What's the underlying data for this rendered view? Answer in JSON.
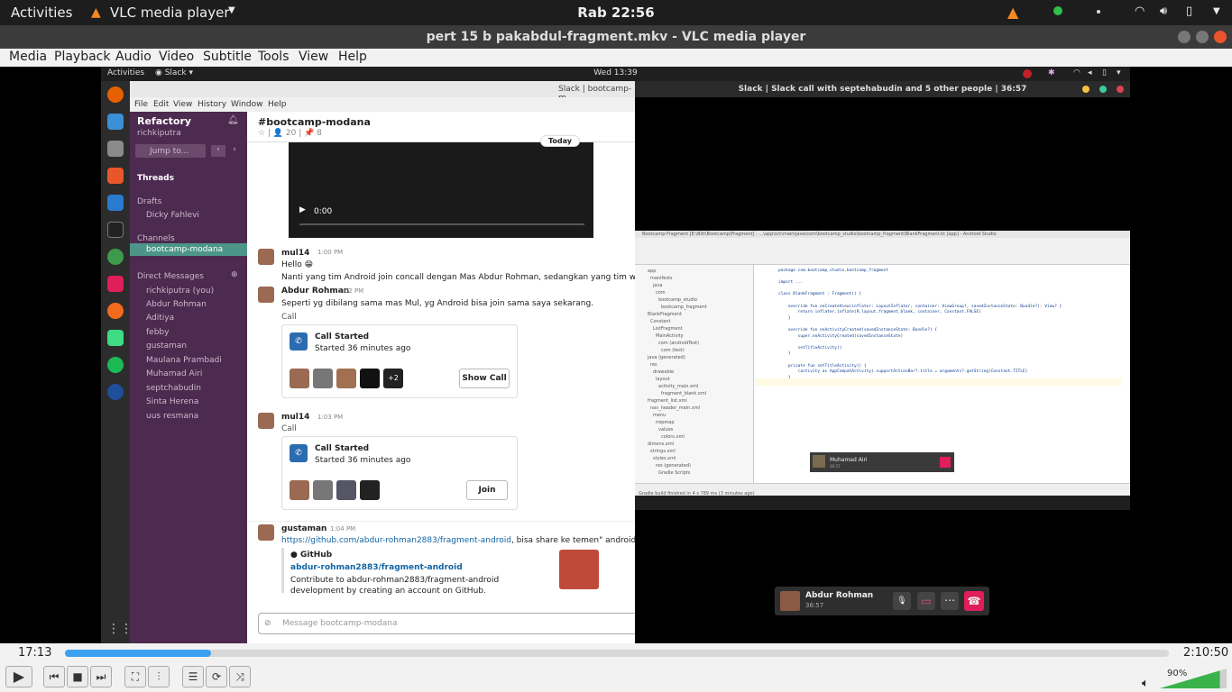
{
  "topbar": {
    "activities": "Activities",
    "app": "VLC media player",
    "clock": "Rab 22:56"
  },
  "window": {
    "title": "pert 15 b pakabdul-fragment.mkv - VLC media player"
  },
  "menu": [
    "Media",
    "Playback",
    "Audio",
    "Video",
    "Subtitle",
    "Tools",
    "View",
    "Help"
  ],
  "inner": {
    "activities": "Activities",
    "app": "Slack",
    "clock": "Wed 13:39",
    "slack_title": "Slack | bootcamp-m",
    "menu": [
      "File",
      "Edit",
      "View",
      "History",
      "Window",
      "Help"
    ],
    "sidebar": {
      "workspace": "Refactory",
      "user": "richkiputra",
      "jump": "Jump to...",
      "threads": "Threads",
      "drafts": "Drafts",
      "draft_user": "Dicky Fahlevi",
      "channels": "Channels",
      "channel": "bootcamp-modana",
      "dms_header": "Direct Messages",
      "dms": [
        "richkiputra (you)",
        "Abdur Rohman",
        "Aditiya",
        "febby",
        "gustaman",
        "Maulana Prambadi",
        "Muhamad Airi",
        "septchabudin",
        "Sinta Herena",
        "uus resmana"
      ]
    },
    "chat": {
      "channel": "#bootcamp-modana",
      "members": "20",
      "pins": "8",
      "today": "Today",
      "video_time": "0:00",
      "m1_user": "mul14",
      "m1_time": "1:00 PM",
      "m1_text1": "Hello 😁",
      "m1_text2": "Nanti yang tim Android join concall dengan Mas Abdur Rohman, sedangkan yang tim web, join di co",
      "m2_user": "Abdur Rohman",
      "m2_time": "1:02 PM",
      "m2_text": "Seperti yg dibilang sama mas Mul, yg Android bisa join sama saya sekarang.",
      "call_label": "Call",
      "call1_title": "Call Started",
      "call1_sub": "Started 36 minutes ago",
      "call1_more": "+2",
      "call1_btn": "Show Call",
      "m3_user": "mul14",
      "m3_time": "1:03 PM",
      "call2_title": "Call Started",
      "call2_sub": "Started 36 minutes ago",
      "call2_btn": "Join",
      "m4_user": "gustaman",
      "m4_time": "1:04 PM",
      "m4_link": "https://github.com/abdur-rohman2883/fragment-android",
      "m4_text": ", bisa share ke temen\" android ya",
      "gh_site": "GitHub",
      "gh_repo": "abdur-rohman2883/fragment-android",
      "gh_desc": "Contribute to abdur-rohman2883/fragment-android development by creating an account on GitHub.",
      "input_placeholder": "Message bootcamp-modana"
    },
    "call_window": "Slack | Slack call with septehabudin and 5 other people | 36:57",
    "studio": {
      "title": "Bootcamp-Fragment [E:\\Bitt\\Bootcamp\\Fragment] - ...\\app\\src\\main\\java\\com\\bootcamp_studio\\bootcamp_fragment\\BlankFragment.kt [app] - Android Studio",
      "tree": [
        "app",
        "manifests",
        "java",
        "com",
        "bootcamp_studio",
        "bootcamp_fragment",
        "BlankFragment",
        "Constant",
        "ListFragment",
        "MainActivity",
        "com (androidTest)",
        "com (test)",
        "java (generated)",
        "res",
        "drawable",
        "layout",
        "activity_main.xml",
        "fragment_blank.xml",
        "fragment_list.xml",
        "nav_header_main.xml",
        "menu",
        "mipmap",
        "values",
        "colors.xml",
        "dimens.xml",
        "strings.xml",
        "styles.xml",
        "res (generated)",
        "Gradle Scripts"
      ],
      "code": [
        "package com.bootcamp_studio.bootcamp_fragment",
        "",
        "import ...",
        "",
        "class BlankFragment : Fragment() {",
        "",
        "    override fun onCreateView(inflater: LayoutInflater, container: ViewGroup?, savedInstanceState: Bundle?): View? {",
        "        return inflater.inflate(R.layout.fragment_blank, container, Constant.FALSE)",
        "    }",
        "",
        "    override fun onActivityCreated(savedInstanceState: Bundle?) {",
        "        super.onActivityCreated(savedInstanceState)",
        "",
        "        setTitleActivity()",
        "    }",
        "",
        "    private fun setTitleActivity() {",
        "        (activity as AppCompatActivity).supportActionBar?.title = arguments?.getString(Constant.TITLE)",
        "    }",
        "}"
      ],
      "status": "Gradle build finished in 4 s 789 ms (3 minutes ago)",
      "mini_call_name": "Muhamad Airi",
      "mini_call_time": "36:57"
    },
    "popup": {
      "name": "Abdur Rohman",
      "time": "36:57"
    }
  },
  "player": {
    "elapsed": "17:13",
    "total": "2:10:50",
    "progress": 0.132,
    "volume": "90%",
    "volume_level": 0.9
  }
}
